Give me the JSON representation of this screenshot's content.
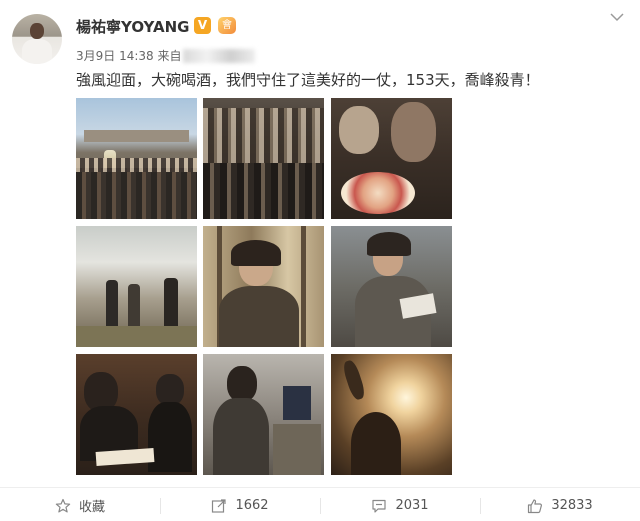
{
  "post": {
    "username": "楊祐寧YOYANG",
    "verified_badge": "V",
    "member_badge": "會",
    "time": "3月9日 14:38 来自",
    "text": "強風迎面，大碗喝酒，我們守住了這美好的一仗，153天，喬峰殺青！"
  },
  "photos": [
    {
      "desc": "crew group photo"
    },
    {
      "desc": "cast crowd celebration"
    },
    {
      "desc": "actors with flower cake"
    },
    {
      "desc": "misty battlefield scene"
    },
    {
      "desc": "actor in forest smiling"
    },
    {
      "desc": "actor reading script"
    },
    {
      "desc": "actor studying script"
    },
    {
      "desc": "actor at monitor"
    },
    {
      "desc": "silhouette in sunlight"
    }
  ],
  "actions": {
    "collect": {
      "label": "收藏",
      "icon": "star-icon"
    },
    "repost": {
      "label": "1662",
      "icon": "repost-icon"
    },
    "comment": {
      "label": "2031",
      "icon": "comment-icon"
    },
    "like": {
      "label": "32833",
      "icon": "thumbs-up-icon"
    }
  },
  "colors": {
    "verified": "#f5a623",
    "text": "#333333",
    "meta": "#666666",
    "icon": "#888888"
  }
}
